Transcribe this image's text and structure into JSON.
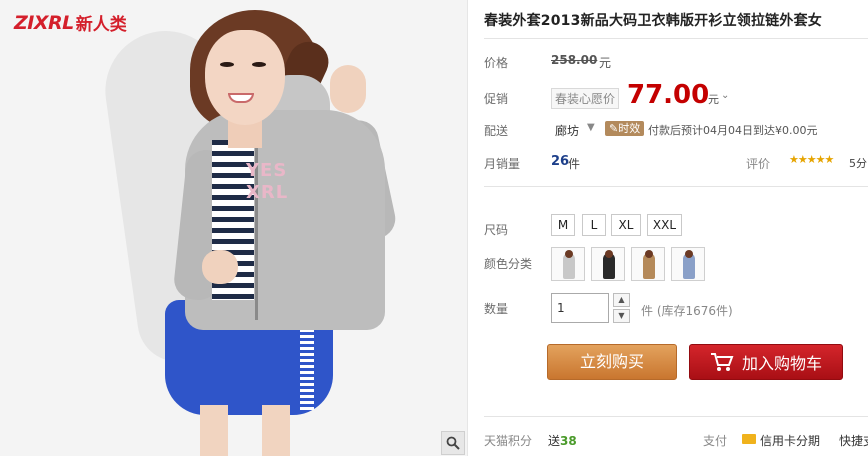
{
  "brand": {
    "logo_text": "ZIXRL",
    "logo_cn": "新人类"
  },
  "product": {
    "title": "春装外套2013新品大码卫衣韩版开衫立领拉链外套女"
  },
  "price": {
    "label": "价格",
    "original": "258.00",
    "unit": "元"
  },
  "promo": {
    "label": "促销",
    "tag": "春装心愿价",
    "price": "77.00",
    "unit": "元"
  },
  "shipping": {
    "label": "配送",
    "city": "廊坊",
    "badge": "时效",
    "text": "付款后预计04月04日到达¥0.00元"
  },
  "sales": {
    "label": "月销量",
    "count": "26",
    "unit": "件",
    "rating_label": "评价",
    "rating_stars": "★★★★★",
    "rating_score": "5分"
  },
  "size": {
    "label": "尺码",
    "options": [
      "M",
      "L",
      "XL",
      "XXL"
    ]
  },
  "color": {
    "label": "颜色分类",
    "swatches": [
      "#c8c8c8",
      "#2a2a2a",
      "#b58a5a",
      "#8aa0c8"
    ]
  },
  "quantity": {
    "label": "数量",
    "value": "1",
    "stock_text": "件 (库存1676件)"
  },
  "actions": {
    "buy_label": "立刻购买",
    "cart_label": "加入购物车"
  },
  "footer": {
    "points_label": "天猫积分",
    "points_prefix": "送",
    "points_value": "38",
    "pay_label": "支付",
    "card_label": "信用卡分期",
    "fast_label": "快捷支"
  },
  "image": {
    "print_text_1": "YES",
    "print_text_2": "XRL"
  },
  "colors": {
    "accent": "#c40000",
    "buy": "#d48c44",
    "cart": "#c0181e"
  }
}
